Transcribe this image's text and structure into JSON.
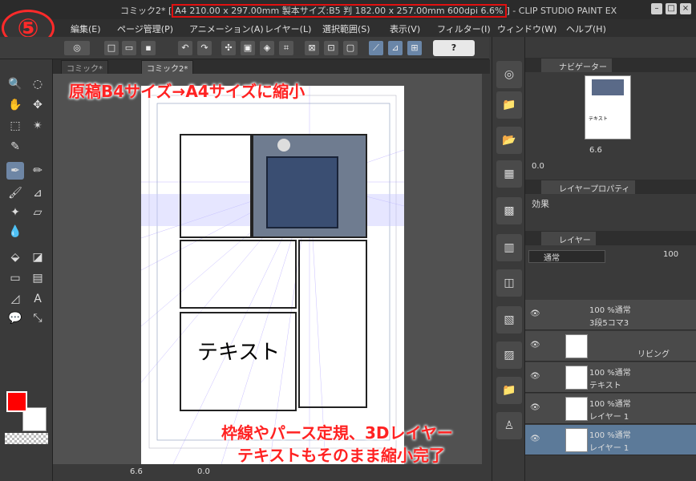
{
  "window": {
    "title_prefix": "コミック2* [",
    "title_highlight": "A4 210.00 x 297.00mm 製本サイズ:B5 判 182.00 x 257.00mm 600dpi 6.6%",
    "title_suffix": "] - CLIP STUDIO PAINT EX"
  },
  "step_badge": "⑤",
  "menu": [
    "編集(E)",
    "ページ管理(P)",
    "アニメーション(A)",
    "レイヤー(L)",
    "選択範囲(S)",
    "表示(V)",
    "フィルター(I)",
    "ウィンドウ(W)",
    "ヘルプ(H)"
  ],
  "toolbar": {
    "help_label": "?"
  },
  "tabs": [
    "コミック*",
    "コミック2*"
  ],
  "canvas": {
    "caption_top": "原稿B4サイズ→A4サイズに縮小",
    "caption_bottom_1": "枠線やパース定規、3Dレイヤー",
    "caption_bottom_2": "テキストもそのまま縮小完了",
    "sample_text": "テキスト"
  },
  "status": {
    "zoom": "6.6",
    "angle": "0.0"
  },
  "navigator": {
    "tab_label": "ナビゲーター",
    "zoom": "6.6",
    "angle": "0.0",
    "preview_text": "テキスト"
  },
  "layer_property": {
    "tab_label": "レイヤープロパティ",
    "effect_label": "効果"
  },
  "layers_panel": {
    "tab_label": "レイヤー",
    "blend_mode": "通常",
    "opacity": "100",
    "layers": [
      {
        "mode": "100 %通常",
        "name": "3段5コマ3",
        "type": "folder"
      },
      {
        "mode": "",
        "name": "リビング",
        "type": "frame3d"
      },
      {
        "mode": "100 %通常",
        "name": "テキスト",
        "type": "text"
      },
      {
        "mode": "100 %通常",
        "name": "レイヤー 1",
        "type": "raster"
      },
      {
        "mode": "100 %通常",
        "name": "レイヤー 1",
        "type": "raster"
      }
    ]
  },
  "colors": {
    "main": "#ff0000",
    "sub": "#ffffff"
  }
}
